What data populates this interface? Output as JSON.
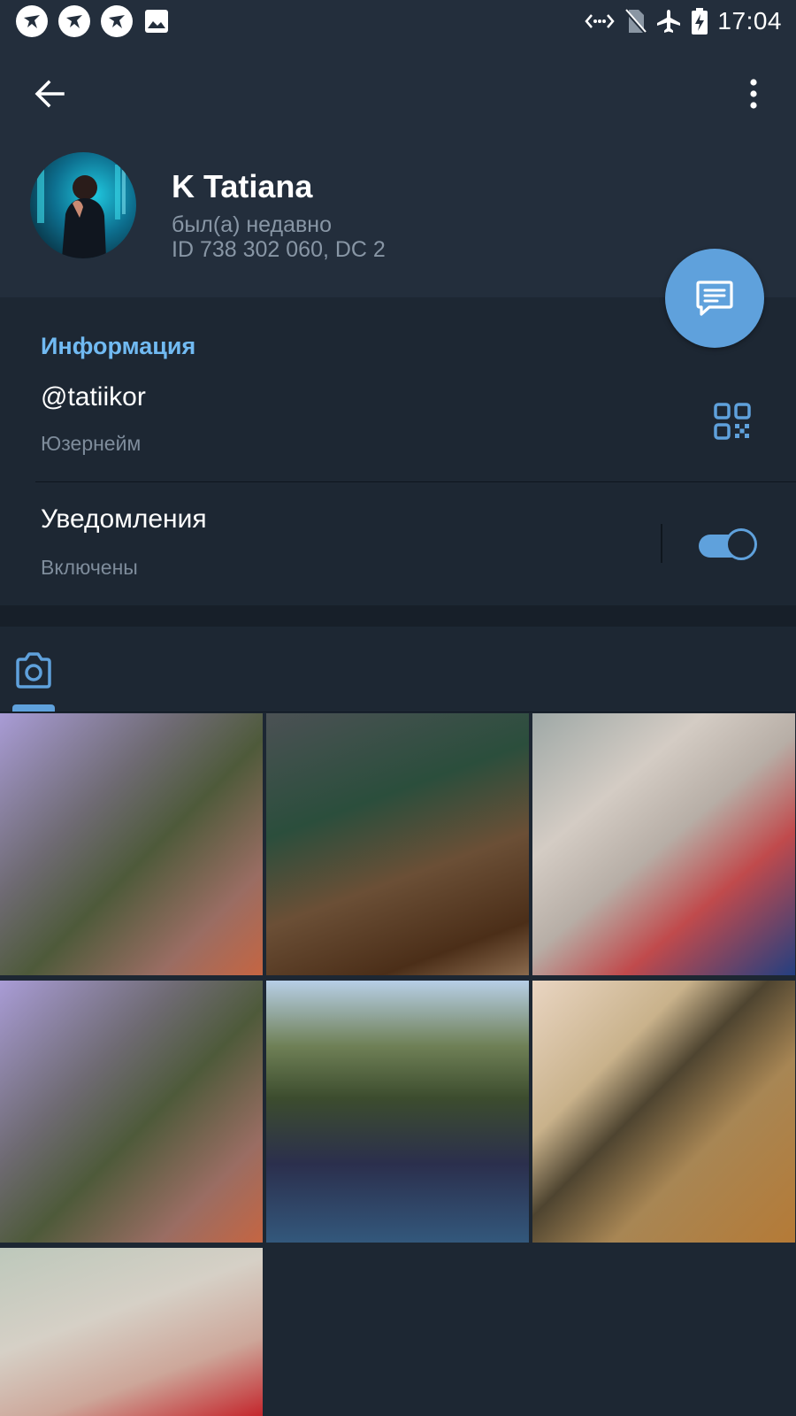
{
  "status_bar": {
    "time": "17:04",
    "left_icons": [
      "app-notification-icon",
      "app-notification-icon",
      "app-notification-icon",
      "gallery-icon"
    ],
    "right_icons": [
      "data-transfer-icon",
      "no-sim-icon",
      "airplane-mode-icon",
      "battery-charging-icon"
    ]
  },
  "toolbar": {
    "back_icon": "back-arrow-icon",
    "menu_icon": "more-vertical-icon"
  },
  "profile": {
    "name": "K Tatiana",
    "status": "был(а) недавно",
    "id_line": "ID 738 302 060, DC 2"
  },
  "fab": {
    "icon": "message-icon"
  },
  "info": {
    "section_title": "Информация",
    "username": "@tatiikor",
    "username_label": "Юзернейм",
    "notifications_label": "Уведомления",
    "notifications_value": "Включены",
    "notifications_enabled": true
  },
  "media": {
    "active_tab_icon": "camera-icon",
    "photo_count": 7
  },
  "colors": {
    "background": "#1d2733",
    "header": "#232e3c",
    "accent": "#5fa1dc",
    "section_title": "#71baf2",
    "secondary_text": "#7e8c9b"
  }
}
